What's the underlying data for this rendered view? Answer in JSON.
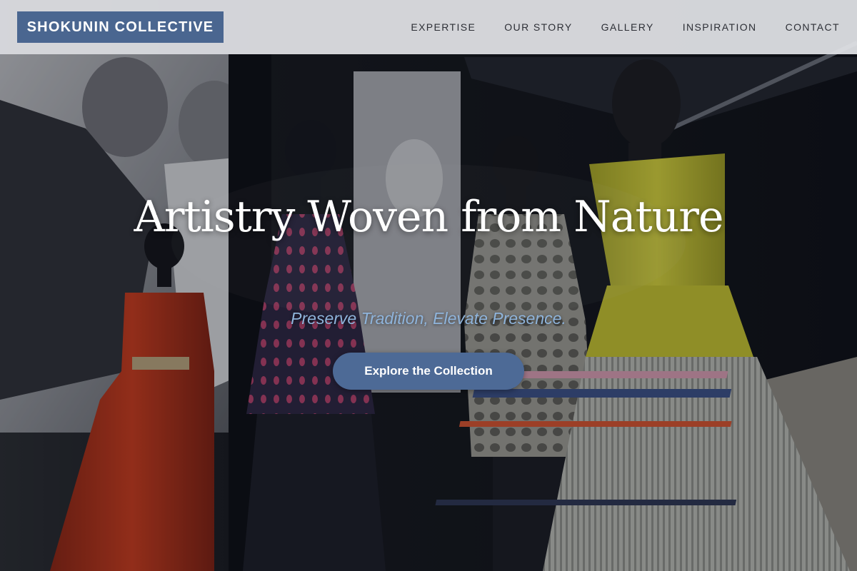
{
  "brand": {
    "name": "SHOKUNIN COLLECTIVE"
  },
  "nav": {
    "items": [
      {
        "label": "EXPERTISE"
      },
      {
        "label": "OUR STORY"
      },
      {
        "label": "GALLERY"
      },
      {
        "label": "INSPIRATION"
      },
      {
        "label": "CONTACT"
      }
    ]
  },
  "hero": {
    "headline": "Artistry Woven from Nature",
    "tagline": "Preserve Tradition, Elevate Presence.",
    "cta_label": "Explore the Collection"
  },
  "colors": {
    "brand_blue": "#4a6690",
    "button_blue": "#4d6a96",
    "tagline_blue": "#8fb4db",
    "header_bg": "#e2e3e7"
  }
}
